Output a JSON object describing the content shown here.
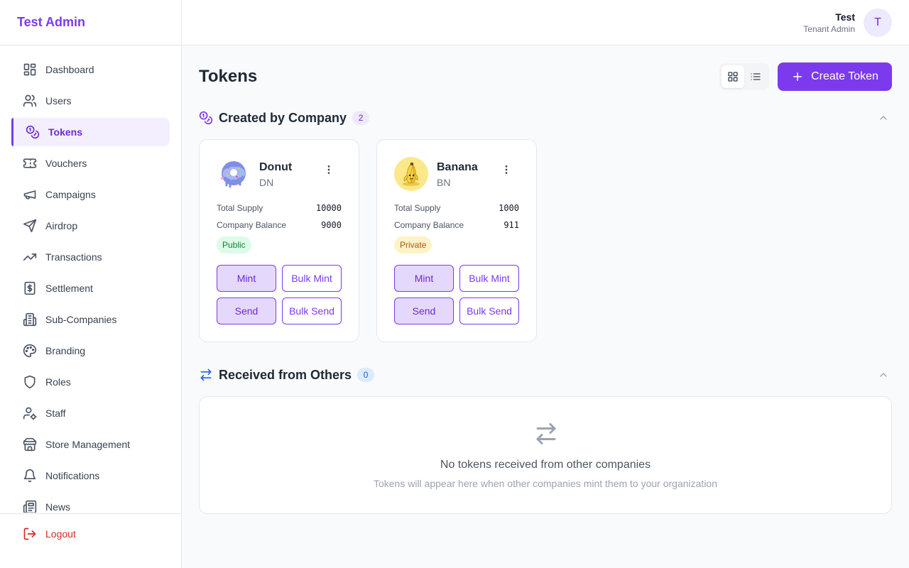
{
  "app": {
    "title": "Test Admin"
  },
  "sidebar": {
    "items": [
      {
        "label": "Dashboard",
        "icon": "dashboard-icon"
      },
      {
        "label": "Users",
        "icon": "users-icon"
      },
      {
        "label": "Tokens",
        "icon": "coins-icon",
        "active": true
      },
      {
        "label": "Vouchers",
        "icon": "ticket-icon"
      },
      {
        "label": "Campaigns",
        "icon": "megaphone-icon"
      },
      {
        "label": "Airdrop",
        "icon": "send-icon"
      },
      {
        "label": "Transactions",
        "icon": "trending-up-icon"
      },
      {
        "label": "Settlement",
        "icon": "receipt-dollar-icon"
      },
      {
        "label": "Sub-Companies",
        "icon": "building-icon"
      },
      {
        "label": "Branding",
        "icon": "palette-icon"
      },
      {
        "label": "Roles",
        "icon": "shield-icon"
      },
      {
        "label": "Staff",
        "icon": "user-cog-icon"
      },
      {
        "label": "Store Management",
        "icon": "store-icon"
      },
      {
        "label": "Notifications",
        "icon": "bell-icon"
      },
      {
        "label": "News",
        "icon": "newspaper-icon"
      }
    ],
    "logout_label": "Logout"
  },
  "header": {
    "user_name": "Test",
    "user_role": "Tenant Admin",
    "avatar_initial": "T"
  },
  "main": {
    "title": "Tokens",
    "create_button_label": "Create Token",
    "view_mode": "grid",
    "created_section": {
      "title": "Created by Company",
      "count": "2",
      "tokens": [
        {
          "name": "Donut",
          "symbol": "DN",
          "image_icon": "donut-icon",
          "total_supply_label": "Total Supply",
          "total_supply": "10000",
          "balance_label": "Company Balance",
          "balance": "9000",
          "visibility": "Public",
          "buttons": {
            "mint": "Mint",
            "bulk_mint": "Bulk Mint",
            "send": "Send",
            "bulk_send": "Bulk Send"
          }
        },
        {
          "name": "Banana",
          "symbol": "BN",
          "image_icon": "banana-icon",
          "total_supply_label": "Total Supply",
          "total_supply": "1000",
          "balance_label": "Company Balance",
          "balance": "911",
          "visibility": "Private",
          "buttons": {
            "mint": "Mint",
            "bulk_mint": "Bulk Mint",
            "send": "Send",
            "bulk_send": "Bulk Send"
          }
        }
      ]
    },
    "received_section": {
      "title": "Received from Others",
      "count": "0",
      "empty_title": "No tokens received from other companies",
      "empty_subtitle": "Tokens will appear here when other companies mint them to your organization"
    }
  },
  "colors": {
    "accent": "#7c3aed",
    "danger": "#dc2626",
    "public_badge": "#dcfce7",
    "private_badge": "#fef3c7"
  }
}
